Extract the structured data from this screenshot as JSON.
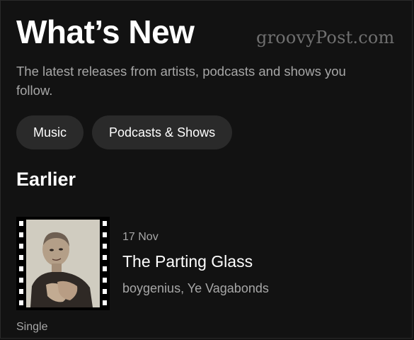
{
  "header": {
    "title": "What’s New",
    "subtitle": "The latest releases from artists, podcasts and shows you follow."
  },
  "watermark": "groovyPost.com",
  "filters": [
    {
      "label": "Music"
    },
    {
      "label": "Podcasts & Shows"
    }
  ],
  "section": {
    "heading": "Earlier"
  },
  "release": {
    "date": "17 Nov",
    "title": "The Parting Glass",
    "artists": "boygenius, Ye Vagabonds",
    "type": "Single"
  },
  "colors": {
    "background": "#121212",
    "chip_background": "#2a2a2a",
    "secondary_text": "#a7a7a7",
    "primary_text": "#ffffff"
  }
}
